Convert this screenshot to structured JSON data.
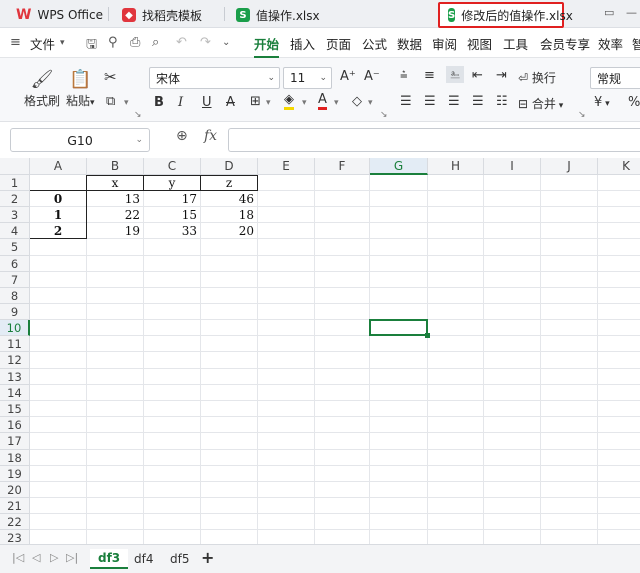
{
  "titlebar": {
    "tabs": [
      {
        "label": "WPS Office"
      },
      {
        "label": "找稻壳模板"
      },
      {
        "label": "值操作.xlsx"
      },
      {
        "label": "修改后的值操作.xlsx"
      }
    ]
  },
  "menubar": {
    "file": "文件",
    "items": [
      "开始",
      "插入",
      "页面",
      "公式",
      "数据",
      "审阅",
      "视图",
      "工具",
      "会员专享",
      "效率",
      "智"
    ]
  },
  "ribbon": {
    "format_painter": "格式刷",
    "paste": "粘贴",
    "font_name": "宋体",
    "font_size": "11",
    "wrap": "换行",
    "merge": "合并",
    "number_format": "常规",
    "currency": "¥",
    "percent": "%"
  },
  "formula": {
    "cell_ref": "G10",
    "content": ""
  },
  "sheet": {
    "columns": [
      "A",
      "B",
      "C",
      "D",
      "E",
      "F",
      "G",
      "H",
      "I",
      "J",
      "K"
    ],
    "rows": [
      "1",
      "2",
      "3",
      "4",
      "5",
      "6",
      "7",
      "8",
      "9",
      "10",
      "11",
      "12",
      "13",
      "14",
      "15",
      "16",
      "17",
      "18",
      "19",
      "20",
      "21",
      "22",
      "23"
    ],
    "header": [
      "",
      "x",
      "y",
      "z"
    ],
    "data": [
      [
        "0",
        "13",
        "17",
        "46"
      ],
      [
        "1",
        "22",
        "15",
        "18"
      ],
      [
        "2",
        "19",
        "33",
        "20"
      ]
    ],
    "selected_column": "G",
    "selected_row": "10"
  },
  "sheet_tabs": [
    "df3",
    "df4",
    "df5"
  ],
  "colors": {
    "accent": "#1a7f3c",
    "highlight_border": "#e02020"
  }
}
